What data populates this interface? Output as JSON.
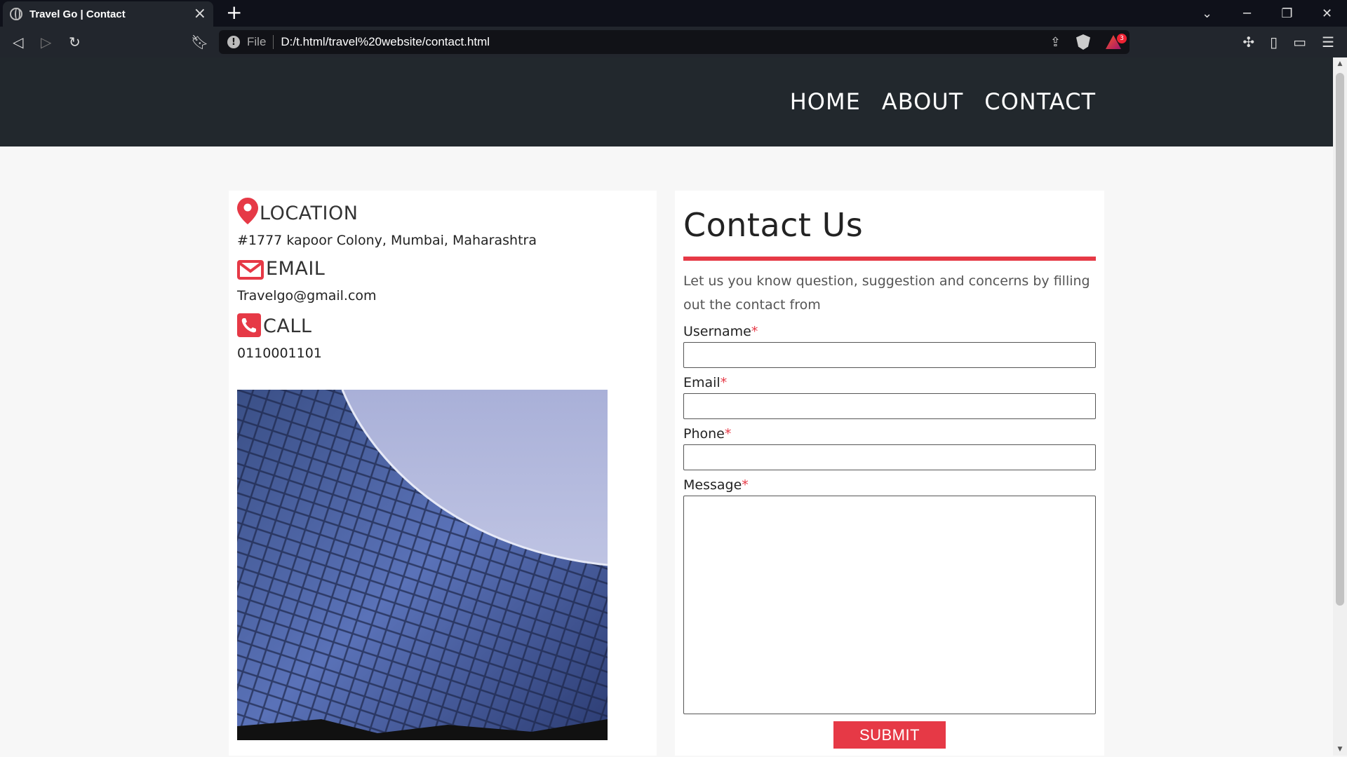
{
  "browser": {
    "tab_title": "Travel Go | Contact",
    "file_label": "File",
    "url": "D:/t.html/travel%20website/contact.html",
    "badge_count": "3"
  },
  "header": {
    "nav": [
      "HOME",
      "ABOUT",
      "CONTACT"
    ]
  },
  "info": {
    "location_heading": "LOCATION",
    "location_text": "#1777 kapoor Colony, Mumbai, Maharashtra",
    "email_heading": "EMAIL",
    "email_text": "Travelgo@gmail.com",
    "call_heading": "CALL",
    "call_text": "0110001101"
  },
  "form": {
    "title": "Contact Us",
    "description": "Let us you know question, suggestion and concerns by filling out the contact from",
    "username_label": "Username",
    "email_label": "Email",
    "phone_label": "Phone",
    "message_label": "Message",
    "required_mark": "*",
    "submit_label": "SUBMIT"
  },
  "colors": {
    "accent": "#e63946",
    "header_bg": "#22282d"
  }
}
